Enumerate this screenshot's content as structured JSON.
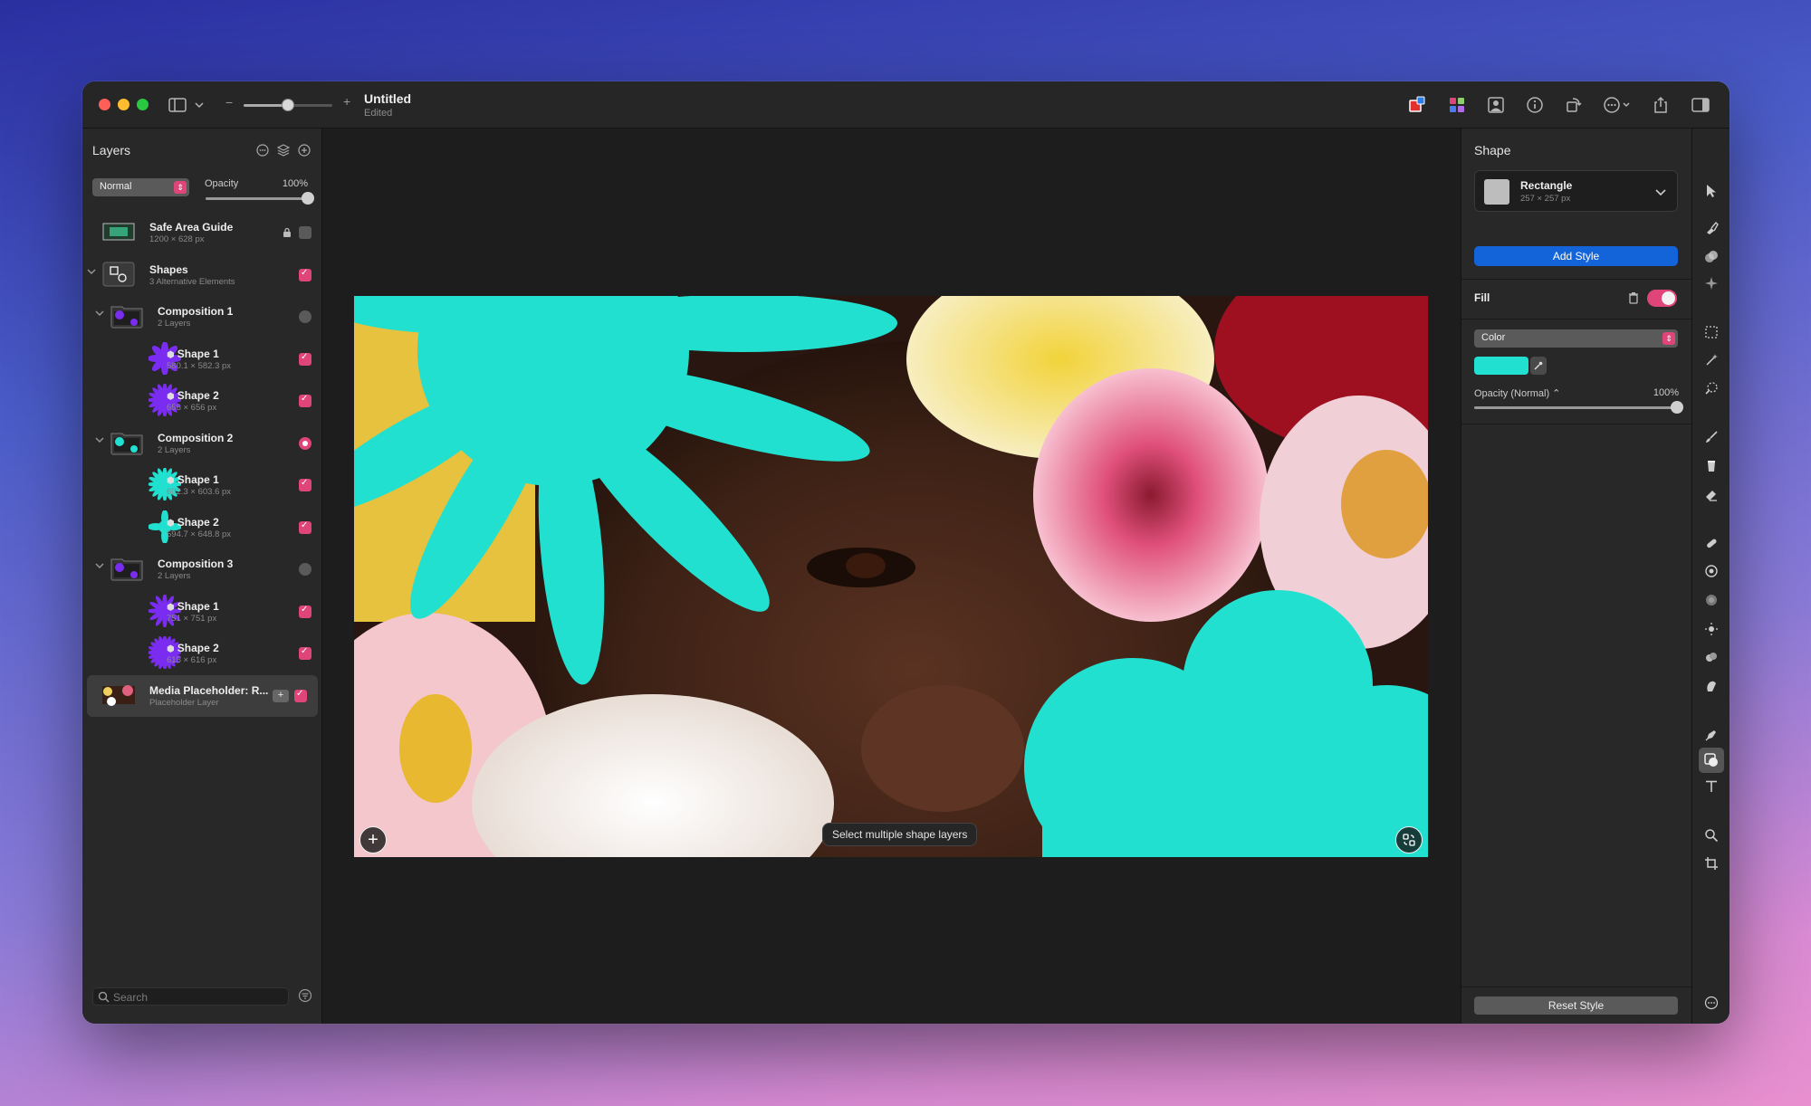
{
  "window": {
    "title": "Untitled",
    "subtitle": "Edited",
    "zoom_level": 0.5
  },
  "left_panel": {
    "title": "Layers",
    "blend_mode": "Normal",
    "opacity_label": "Opacity",
    "opacity_value": "100%",
    "opacity_fraction": 1.0,
    "search_placeholder": "Search",
    "layers": [
      {
        "name": "Safe Area Guide",
        "sub": "1200 × 628 px",
        "indent": 0,
        "chevron": false,
        "locked": true,
        "vis": "off",
        "thumb": "guide"
      },
      {
        "name": "Shapes",
        "sub": "3 Alternative Elements",
        "indent": 0,
        "chevron": true,
        "vis": "on",
        "thumb": "shapes"
      },
      {
        "name": "Composition 1",
        "sub": "2 Layers",
        "indent": 1,
        "chevron": true,
        "vis": "radio-off",
        "thumb": "comp-purple"
      },
      {
        "name": "Shape 1",
        "sub": "580.1 × 582.3 px",
        "indent": 2,
        "vis": "on",
        "thumb": "flower-purple-8",
        "shape_icon": true
      },
      {
        "name": "Shape 2",
        "sub": "656 × 656 px",
        "indent": 2,
        "vis": "on",
        "thumb": "flower-purple-16",
        "shape_icon": true
      },
      {
        "name": "Composition 2",
        "sub": "2 Layers",
        "indent": 1,
        "chevron": true,
        "vis": "radio-on",
        "thumb": "comp-teal"
      },
      {
        "name": "Shape 1",
        "sub": "602.3 × 603.6 px",
        "indent": 2,
        "vis": "on",
        "thumb": "flower-teal-16",
        "shape_icon": true
      },
      {
        "name": "Shape 2",
        "sub": "594.7 × 648.8 px",
        "indent": 2,
        "vis": "on",
        "thumb": "flower-teal-4",
        "shape_icon": true
      },
      {
        "name": "Composition 3",
        "sub": "2 Layers",
        "indent": 1,
        "chevron": true,
        "vis": "radio-off",
        "thumb": "comp-purple"
      },
      {
        "name": "Shape 1",
        "sub": "751 × 751 px",
        "indent": 2,
        "vis": "on",
        "thumb": "flower-purple-12",
        "shape_icon": true
      },
      {
        "name": "Shape 2",
        "sub": "615 × 616 px",
        "indent": 2,
        "vis": "on",
        "thumb": "flower-purple-20",
        "shape_icon": true
      },
      {
        "name": "Media Placeholder: R...",
        "sub": "Placeholder Layer",
        "indent": 0,
        "selected": true,
        "vis": "on",
        "plus": true,
        "thumb": "photo"
      }
    ]
  },
  "canvas": {
    "hint": "Select multiple shape layers"
  },
  "right_panel": {
    "title": "Shape",
    "shape_name": "Rectangle",
    "shape_dims": "257 × 257 px",
    "add_style_label": "Add Style",
    "fill_label": "Fill",
    "fill_type": "Color",
    "opacity_label": "Opacity (Normal) ⌃",
    "opacity_value": "100%",
    "opacity_fraction": 1.0,
    "reset_label": "Reset Style"
  },
  "colors": {
    "accent_pink": "#e0457a",
    "teal_fill": "#22e0d0",
    "blue_button": "#1464d9",
    "purple_shape": "#7a2df0"
  }
}
